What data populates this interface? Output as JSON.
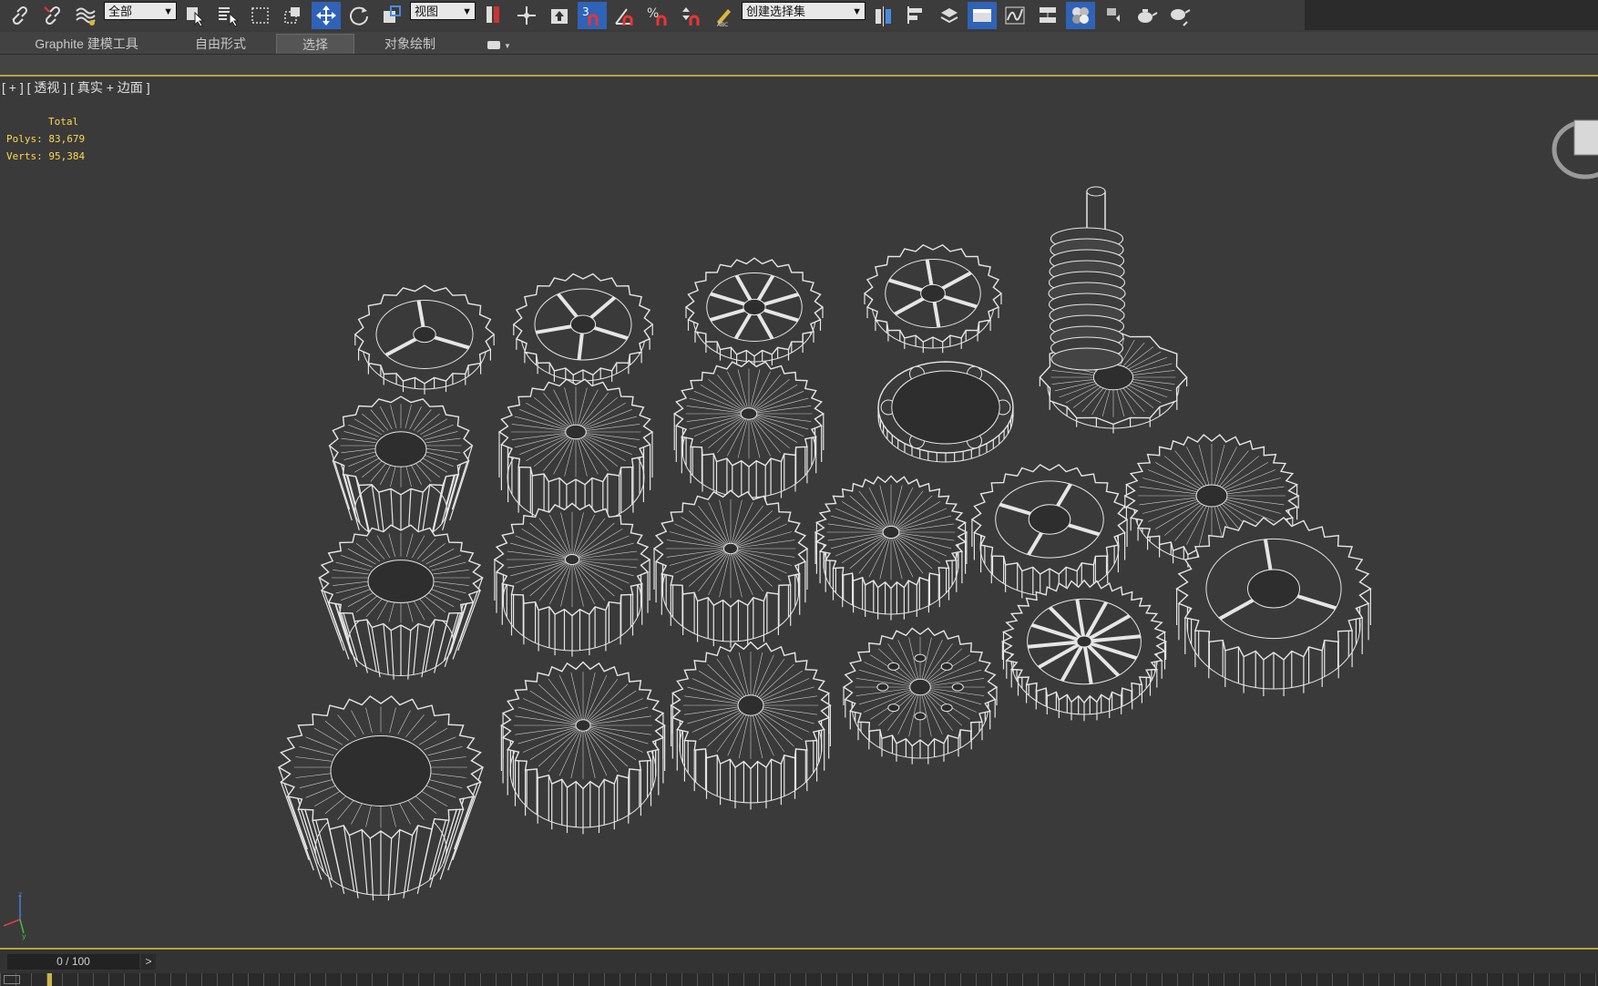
{
  "toolbar": {
    "filter_dropdown": "全部",
    "refcoord_dropdown": "视图",
    "selection_set_dropdown": "创建选择集"
  },
  "ribbon": {
    "tabs": [
      "Graphite 建模工具",
      "自由形式",
      "选择",
      "对象绘制"
    ],
    "active_tab": "选择"
  },
  "viewport": {
    "label": "[ + ] [ 透视 ] [ 真实 + 边面 ]",
    "stats": {
      "total_label": "Total",
      "polys": "Polys: 83,679",
      "verts": "Verts: 95,384"
    }
  },
  "timeline": {
    "frame": "0 / 100",
    "next": ">"
  },
  "colors": {
    "accent": "#2f63b8",
    "stats_text": "#ffd84a",
    "gear_wire": "#e6e6e6",
    "timeline_border": "#b8a23a"
  }
}
